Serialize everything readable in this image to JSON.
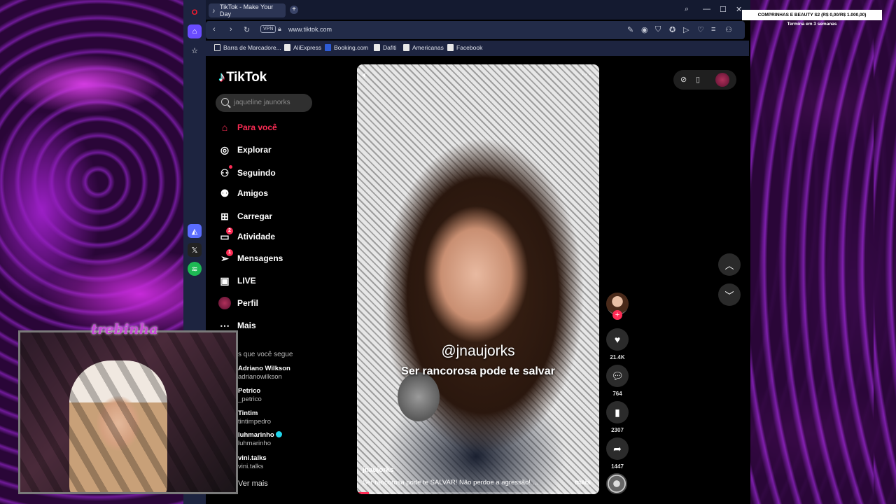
{
  "browser": {
    "tab_title": "TikTok - Make Your Day",
    "url": "www.tiktok.com",
    "vpn_label": "VPN",
    "bookmarks": [
      "Barra de Marcadore...",
      "AliExpress",
      "Booking.com",
      "Dafiti",
      "Americanas",
      "Facebook"
    ]
  },
  "tiktok": {
    "logo": "TikTok",
    "search_placeholder": "jaqueline jaunorks",
    "nav": [
      {
        "label": "Para você",
        "icon": "home-icon"
      },
      {
        "label": "Explorar",
        "icon": "compass-icon"
      },
      {
        "label": "Seguindo",
        "icon": "following-icon"
      },
      {
        "label": "Amigos",
        "icon": "friends-icon"
      },
      {
        "label": "Carregar",
        "icon": "upload-icon"
      },
      {
        "label": "Atividade",
        "icon": "activity-icon",
        "badge": "2"
      },
      {
        "label": "Mensagens",
        "icon": "messages-icon",
        "badge": "1"
      },
      {
        "label": "LIVE",
        "icon": "live-icon"
      },
      {
        "label": "Perfil",
        "icon": "profile-avatar"
      },
      {
        "label": "Mais",
        "icon": "more-icon"
      }
    ],
    "following_title": "s que você segue",
    "following": [
      {
        "name": "Adriano Wilkson",
        "handle": "adrianowilkson"
      },
      {
        "name": "Petrico",
        "handle": "_petrico"
      },
      {
        "name": "Tintim",
        "handle": "tintimpedro"
      },
      {
        "name": "luhmarinho",
        "handle": "luhmarinho",
        "verified": true
      },
      {
        "name": "vini.talks",
        "handle": "vini.talks"
      }
    ],
    "see_more": "Ver mais",
    "video": {
      "overlay_handle": "@jnaujorks",
      "overlay_caption": "Ser rancorosa pode te salvar",
      "author": "jnaujorks",
      "description": "Ser rancorosa pode te SALVAR! Não perdoe a agressão! ...",
      "more": "mais",
      "progress": 0.05
    },
    "actions": {
      "likes": "21.4K",
      "comments": "764",
      "saves": "2307",
      "shares": "1447"
    }
  },
  "stream": {
    "webcam_name": "trebinha",
    "goal_text": "COMPRINHAS E BEAUTY S2 (R$ 0,00/R$ 1.000,00)",
    "goal_sub": "Termina em 3 semanas"
  }
}
